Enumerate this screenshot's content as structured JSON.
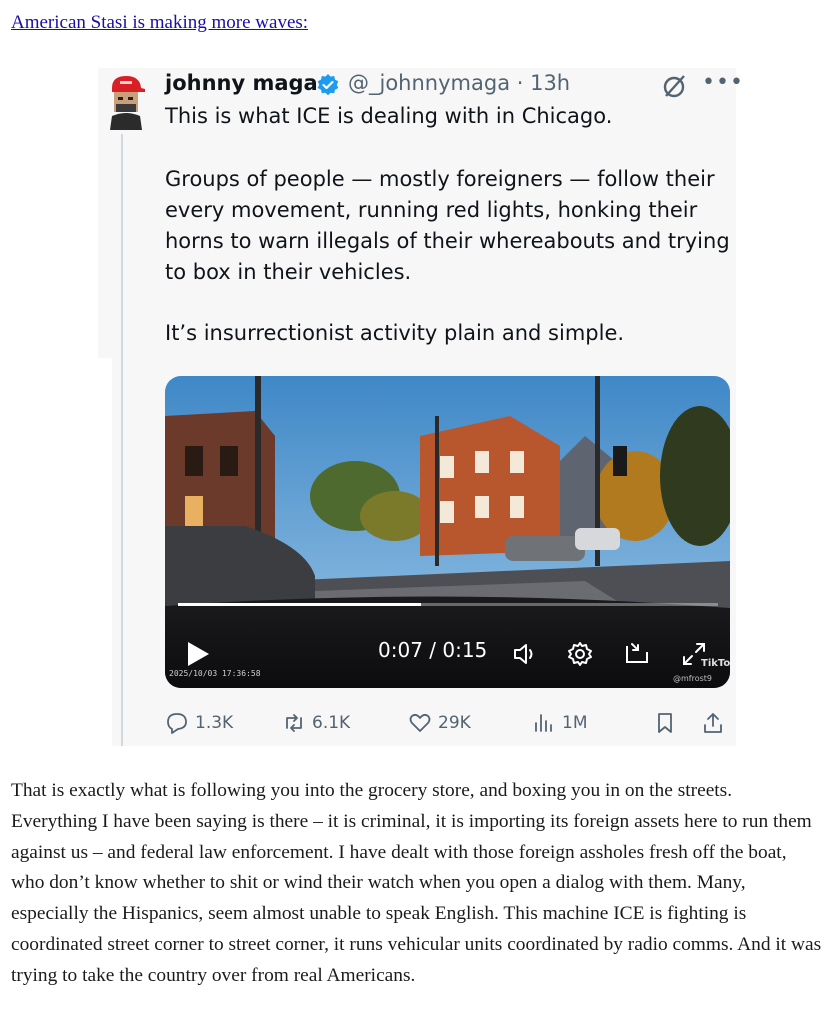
{
  "intro_link": "American Stasi is making more waves:",
  "tweet": {
    "name": "johnny maga",
    "handle_time": "@_johnnymaga · 13h",
    "more": "•••",
    "paragraphs": [
      "This is what ICE is dealing with in Chicago.",
      "Groups of people — mostly foreigners — follow their every movement, running red lights, honking their horns to warn illegals of their whereabouts and trying to box in their vehicles.",
      "It’s insurrectionist activity plain and simple."
    ],
    "video": {
      "time": "0:07 / 0:15",
      "progress": 0.45,
      "dashcam_stamp": "2025/10/03 17:36:58",
      "watermark": "TikTok",
      "watermark_user": "@mfrost9"
    },
    "actions": {
      "replies": "1.3K",
      "reposts": "6.1K",
      "likes": "29K",
      "views": "1M"
    }
  },
  "body_text": "That is exactly what is following you into the grocery store, and boxing you in on the streets. Everything I have been saying is there – it is criminal, it is importing its foreign assets here to run them against us – and federal law enforcement. I have dealt with those foreign assholes fresh off the boat, who don’t know whether to shit or wind their watch when you open a dialog with them. Many, especially the Hispanics, seem almost unable to speak English. This machine ICE is fighting is coordinated street corner to street corner, it runs vehicular units coordinated by radio comms. And it was trying to take the country over from real Americans."
}
